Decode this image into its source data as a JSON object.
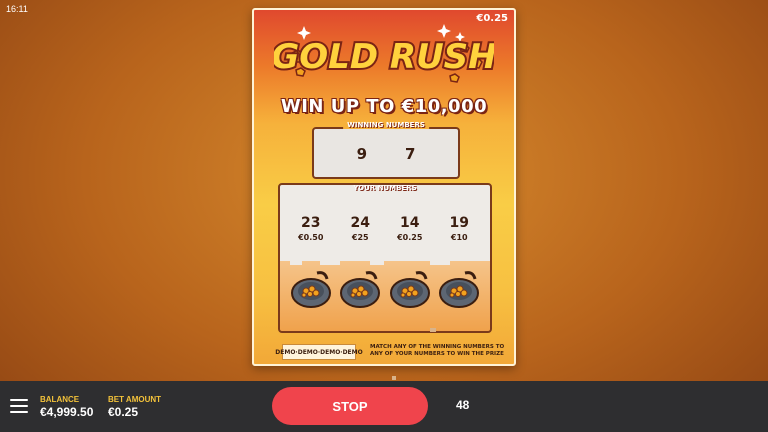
{
  "status_bar": {
    "time": "16:11"
  },
  "ticket": {
    "price": "€0.25",
    "logo_text": "GOLD RUSH",
    "headline": "WIN UP TO €10,000",
    "winning_numbers_label": "WINNING NUMBERS",
    "winning_numbers": [
      "9",
      "7"
    ],
    "your_numbers_label": "YOUR NUMBERS",
    "your_numbers": [
      {
        "number": "23",
        "prize": "€0.50"
      },
      {
        "number": "24",
        "prize": "€25"
      },
      {
        "number": "14",
        "prize": "€0.25"
      },
      {
        "number": "19",
        "prize": "€10"
      }
    ],
    "pan_icon": "gold-pan-icon",
    "demo_badge": "DEMO·DEMO·DEMO·DEMO",
    "rules_text": "MATCH ANY OF THE WINNING NUMBERS TO ANY OF YOUR NUMBERS TO WIN THE PRIZE"
  },
  "bottom_bar": {
    "menu_icon": "hamburger-menu-icon",
    "balance_label": "BALANCE",
    "balance_value": "€4,999.50",
    "bet_label": "BET AMOUNT",
    "bet_value": "€0.25",
    "stop_label": "STOP",
    "autoplay_count": "48"
  },
  "colors": {
    "stop_button": "#f0444c",
    "label_yellow": "#f3c23a",
    "bar_background": "#2e2e30"
  }
}
